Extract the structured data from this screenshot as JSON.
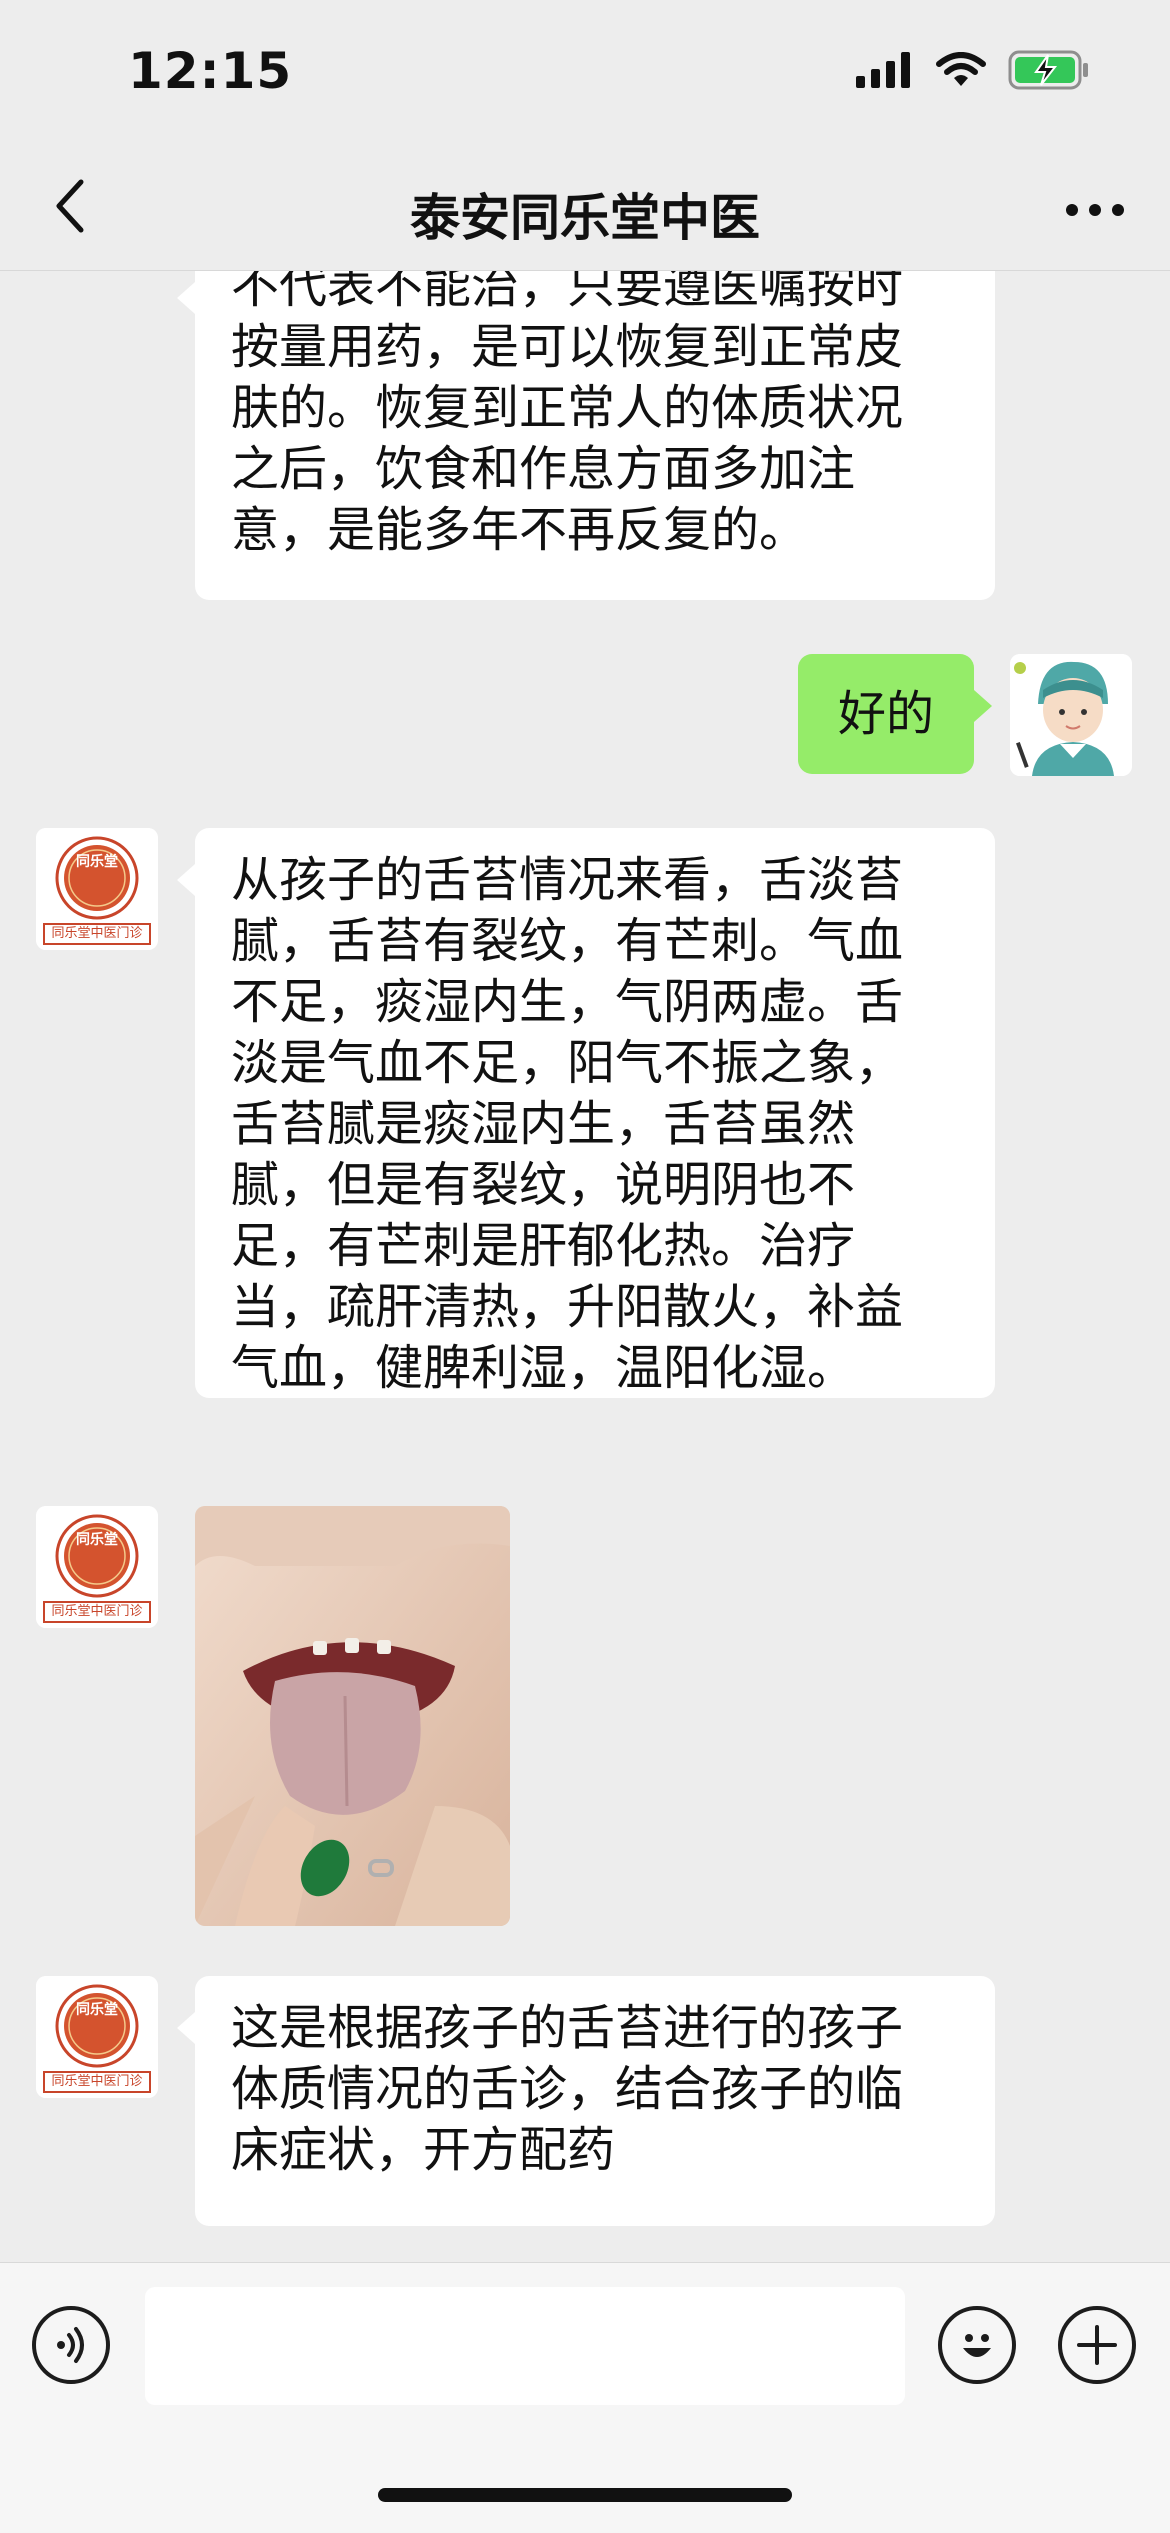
{
  "status": {
    "time": "12:15"
  },
  "nav": {
    "title": "泰安同乐堂中医"
  },
  "messages": [
    {
      "lines": [
        "不代表不能治，只要遵医嘱按时",
        "按量用药，是可以恢复到正常皮",
        "肤的。恢复到正常人的体质状况",
        "之后，饮食和作息方面多加注",
        "意，是能多年不再反复的。"
      ]
    },
    {
      "lines": [
        "好的"
      ]
    },
    {
      "lines": [
        "从孩子的舌苔情况来看，舌淡苔",
        "腻，舌苔有裂纹，有芒刺。气血",
        "不足，痰湿内生，气阴两虚。舌",
        "淡是气血不足，阳气不振之象，",
        "舌苔腻是痰湿内生，舌苔虽然",
        "腻，但是有裂纹，说明阴也不",
        "足，有芒刺是肝郁化热。治疗",
        "当，疏肝清热，升阳散火，补益",
        "气血，健脾利湿，温阳化湿。"
      ]
    },
    {
      "lines": [
        "这是根据孩子的舌苔进行的孩子",
        "体质情况的舌诊，结合孩子的临",
        "床症状，开方配药"
      ]
    }
  ],
  "clinic_avatar": {
    "seal_top": "同乐堂",
    "seal_bottom": "同乐堂中医门诊"
  },
  "icons": {
    "back": "chevron-left-icon",
    "more": "more-dots-icon",
    "voice": "voice-icon",
    "emoji": "emoji-icon",
    "plus": "plus-icon",
    "signal": "signal-icon",
    "wifi": "wifi-icon",
    "battery": "battery-charging-icon"
  },
  "colors": {
    "self_bubble": "#95ec69",
    "other_bubble": "#ffffff",
    "background": "#ededed",
    "seal": "#c8452a",
    "battery": "#34c759"
  }
}
